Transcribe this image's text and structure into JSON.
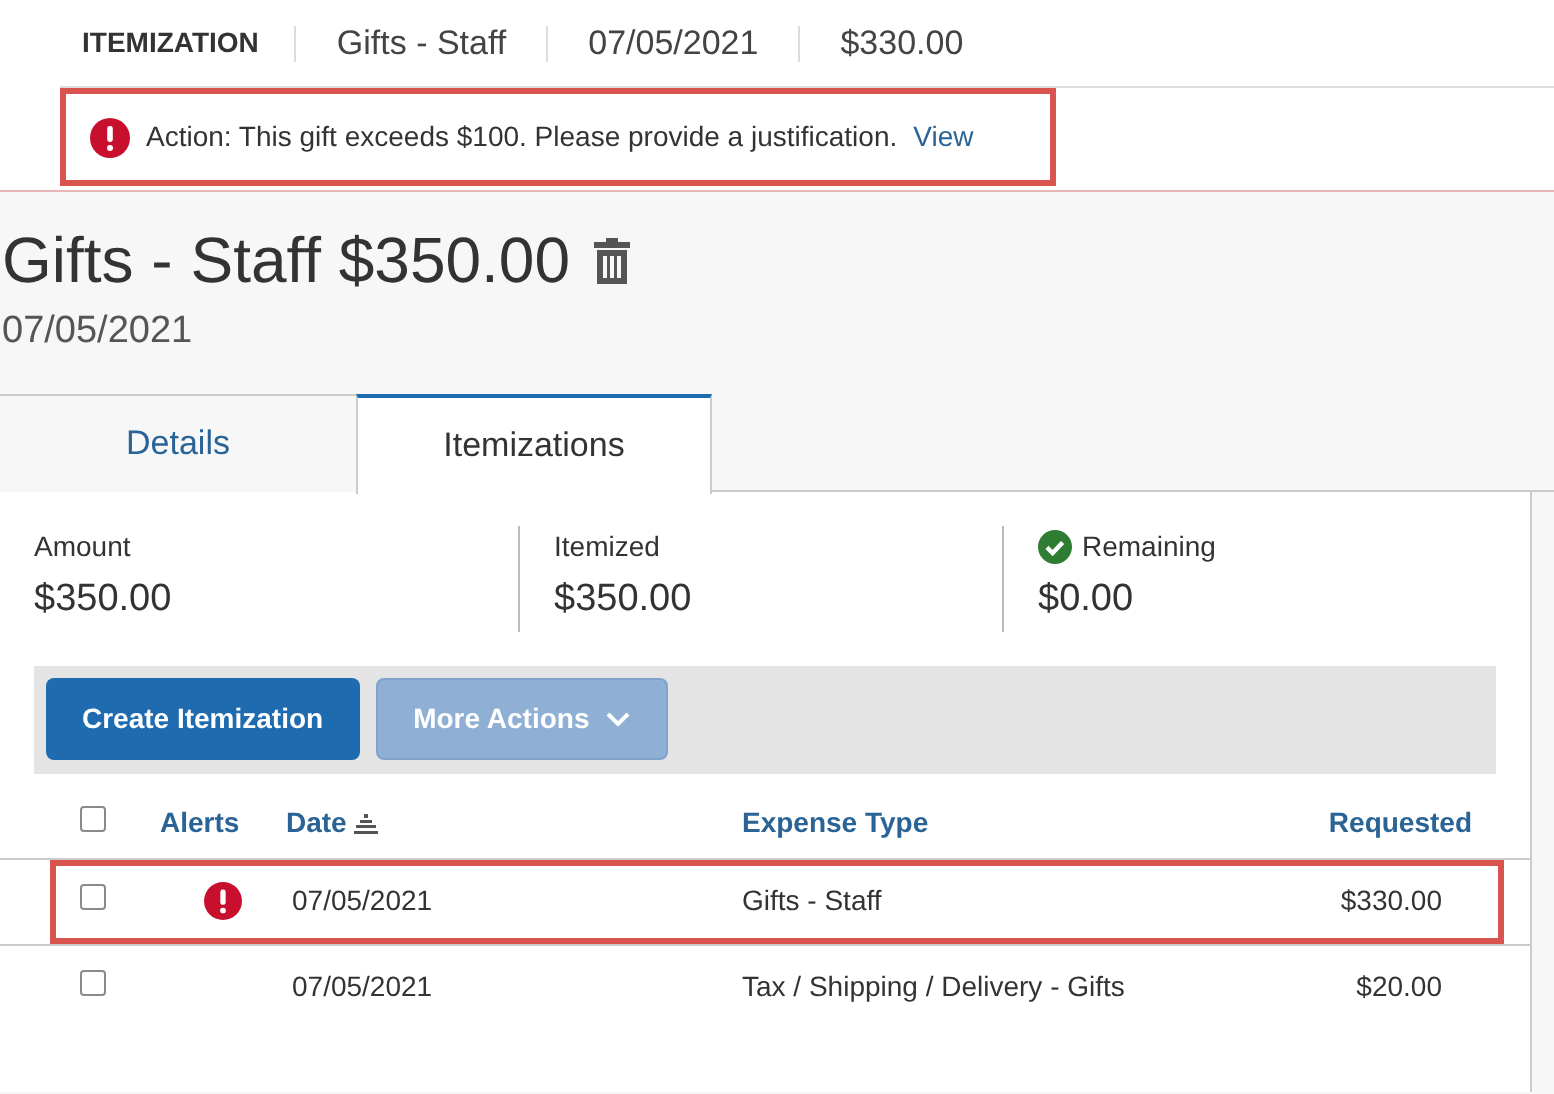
{
  "header": {
    "label": "ITEMIZATION",
    "items": [
      "Gifts - Staff",
      "07/05/2021",
      "$330.00"
    ]
  },
  "alert": {
    "text": "Action: This gift exceeds $100. Please provide a justification.",
    "link": "View",
    "highlighted": true
  },
  "expense": {
    "title": "Gifts - Staff $350.00",
    "date": "07/05/2021"
  },
  "tabs": [
    {
      "label": "Details",
      "selected": false
    },
    {
      "label": "Itemizations",
      "selected": true
    }
  ],
  "summary": [
    {
      "label": "Amount",
      "value": "$350.00",
      "ok": false
    },
    {
      "label": "Itemized",
      "value": "$350.00",
      "ok": false
    },
    {
      "label": "Remaining",
      "value": "$0.00",
      "ok": true
    }
  ],
  "toolbar": [
    {
      "label": "Create Itemization",
      "disabled": false,
      "dropdown": false
    },
    {
      "label": "More Actions",
      "disabled": true,
      "dropdown": true
    }
  ],
  "table": {
    "columns": [
      "Alerts",
      "Date",
      "Expense Type",
      "Requested"
    ],
    "header_checked": false,
    "rows": [
      {
        "checked": false,
        "alert": true,
        "highlighted": true,
        "date": "07/05/2021",
        "type": "Gifts - Staff",
        "requested": "$330.00"
      },
      {
        "checked": false,
        "alert": false,
        "highlighted": false,
        "date": "07/05/2021",
        "type": "Tax / Shipping / Delivery - Gifts",
        "requested": "$20.00"
      }
    ]
  }
}
